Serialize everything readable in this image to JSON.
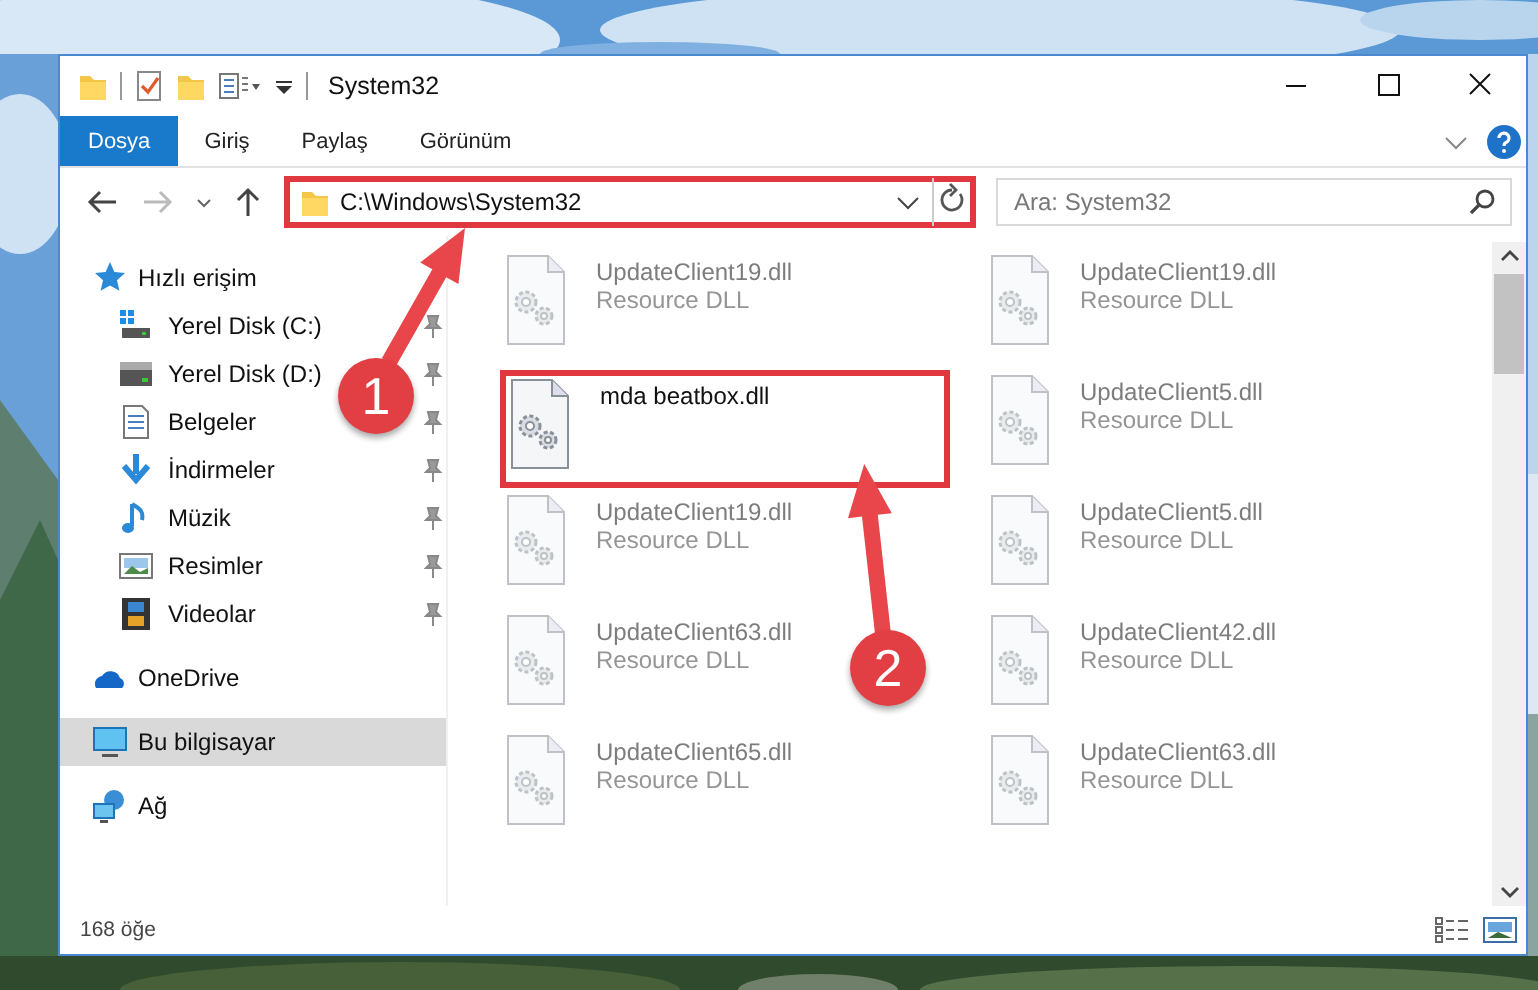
{
  "window": {
    "title": "System32"
  },
  "ribbon_tabs": [
    {
      "label": "Dosya",
      "selected": true
    },
    {
      "label": "Giriş",
      "selected": false
    },
    {
      "label": "Paylaş",
      "selected": false
    },
    {
      "label": "Görünüm",
      "selected": false
    }
  ],
  "address_bar": {
    "path": "C:\\Windows\\System32",
    "highlighted": true
  },
  "search": {
    "placeholder": "Ara: System32"
  },
  "sidebar": {
    "items": [
      {
        "label": "Hızlı erişim",
        "kind": "quick",
        "selected": false,
        "children": [
          {
            "label": "Yerel Disk (C:)",
            "kind": "drive-c",
            "pinned": true
          },
          {
            "label": "Yerel Disk (D:)",
            "kind": "drive",
            "pinned": true
          },
          {
            "label": "Belgeler",
            "kind": "documents",
            "pinned": true
          },
          {
            "label": "İndirmeler",
            "kind": "downloads",
            "pinned": true
          },
          {
            "label": "Müzik",
            "kind": "music",
            "pinned": true
          },
          {
            "label": "Resimler",
            "kind": "pictures",
            "pinned": true
          },
          {
            "label": "Videolar",
            "kind": "videos",
            "pinned": true
          }
        ]
      },
      {
        "label": "OneDrive",
        "kind": "cloud",
        "selected": false
      },
      {
        "label": "Bu bilgisayar",
        "kind": "computer",
        "selected": true
      },
      {
        "label": "Ağ",
        "kind": "network",
        "selected": false
      }
    ]
  },
  "files": [
    {
      "name": "UpdateClient19.dll",
      "type": "Resource DLL",
      "blurred": true,
      "highlighted": false
    },
    {
      "name": "UpdateClient19.dll",
      "type": "Resource DLL",
      "blurred": true,
      "highlighted": false
    },
    {
      "name": "mda beatbox.dll",
      "blurred": false,
      "highlighted": true
    },
    {
      "name": "UpdateClient5.dll",
      "type": "Resource DLL",
      "blurred": true,
      "highlighted": false
    },
    {
      "name": "UpdateClient19.dll",
      "type": "Resource DLL",
      "blurred": true,
      "highlighted": false
    },
    {
      "name": "UpdateClient5.dll",
      "type": "Resource DLL",
      "blurred": true,
      "highlighted": false
    },
    {
      "name": "UpdateClient63.dll",
      "type": "Resource DLL",
      "blurred": true,
      "highlighted": false
    },
    {
      "name": "UpdateClient42.dll",
      "type": "Resource DLL",
      "blurred": true,
      "highlighted": false
    },
    {
      "name": "UpdateClient65.dll",
      "type": "Resource DLL",
      "blurred": true,
      "highlighted": false
    },
    {
      "name": "UpdateClient63.dll",
      "type": "Resource DLL",
      "blurred": true,
      "highlighted": false
    }
  ],
  "status_bar": {
    "count": "168 öğe"
  },
  "callouts": [
    {
      "label": "1"
    },
    {
      "label": "2"
    }
  ]
}
